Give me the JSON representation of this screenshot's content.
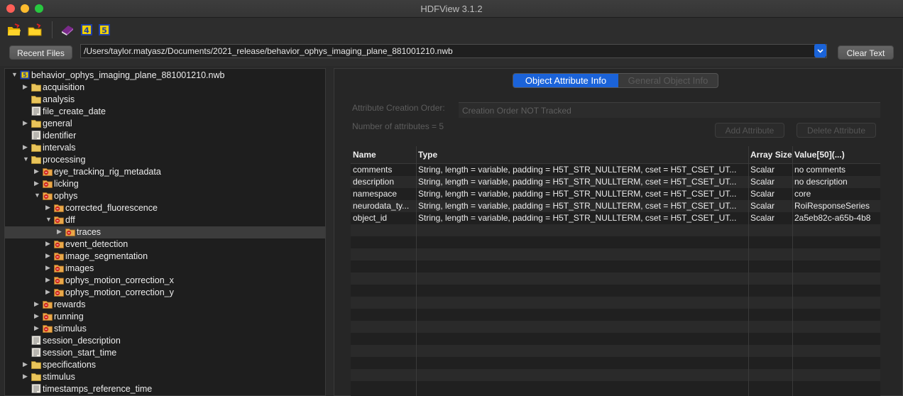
{
  "window": {
    "title": "HDFView 3.1.2"
  },
  "toolbar": {
    "icons": [
      "open-file-icon",
      "open-folder-icon",
      "help-book-icon",
      "hdf4-icon",
      "hdf5-icon"
    ]
  },
  "file_bar": {
    "recent_files_label": "Recent Files",
    "path": "/Users/taylor.matyasz/Documents/2021_release/behavior_ophys_imaging_plane_881001210.nwb",
    "clear_text_label": "Clear Text"
  },
  "tree": {
    "items": [
      {
        "label": "behavior_ophys_imaging_plane_881001210.nwb",
        "icon": "hdf5-file-icon",
        "depth": 0,
        "expanded": true
      },
      {
        "label": "acquisition",
        "icon": "folder-icon",
        "depth": 1,
        "expanded": false
      },
      {
        "label": "analysis",
        "icon": "folder-icon",
        "depth": 1,
        "leaf": true
      },
      {
        "label": "file_create_date",
        "icon": "dataset-icon",
        "depth": 1,
        "leaf": true
      },
      {
        "label": "general",
        "icon": "folder-icon",
        "depth": 1,
        "expanded": false
      },
      {
        "label": "identifier",
        "icon": "dataset-icon",
        "depth": 1,
        "leaf": true
      },
      {
        "label": "intervals",
        "icon": "folder-icon",
        "depth": 1,
        "expanded": false
      },
      {
        "label": "processing",
        "icon": "folder-icon",
        "depth": 1,
        "expanded": true
      },
      {
        "label": "eye_tracking_rig_metadata",
        "icon": "group-attr-icon",
        "depth": 2,
        "expanded": false
      },
      {
        "label": "licking",
        "icon": "group-attr-icon",
        "depth": 2,
        "expanded": false
      },
      {
        "label": "ophys",
        "icon": "group-attr-icon",
        "depth": 2,
        "expanded": true
      },
      {
        "label": "corrected_fluorescence",
        "icon": "group-attr-icon",
        "depth": 3,
        "expanded": false
      },
      {
        "label": "dff",
        "icon": "group-attr-icon",
        "depth": 3,
        "expanded": true
      },
      {
        "label": "traces",
        "icon": "group-attr-icon",
        "depth": 4,
        "expanded": false,
        "selected": true
      },
      {
        "label": "event_detection",
        "icon": "group-attr-icon",
        "depth": 3,
        "expanded": false
      },
      {
        "label": "image_segmentation",
        "icon": "group-attr-icon",
        "depth": 3,
        "expanded": false
      },
      {
        "label": "images",
        "icon": "group-attr-icon",
        "depth": 3,
        "expanded": false
      },
      {
        "label": "ophys_motion_correction_x",
        "icon": "group-attr-icon",
        "depth": 3,
        "expanded": false
      },
      {
        "label": "ophys_motion_correction_y",
        "icon": "group-attr-icon",
        "depth": 3,
        "expanded": false
      },
      {
        "label": "rewards",
        "icon": "group-attr-icon",
        "depth": 2,
        "expanded": false
      },
      {
        "label": "running",
        "icon": "group-attr-icon",
        "depth": 2,
        "expanded": false
      },
      {
        "label": "stimulus",
        "icon": "group-attr-icon",
        "depth": 2,
        "expanded": false
      },
      {
        "label": "session_description",
        "icon": "dataset-icon",
        "depth": 1,
        "leaf": true
      },
      {
        "label": "session_start_time",
        "icon": "dataset-icon",
        "depth": 1,
        "leaf": true
      },
      {
        "label": "specifications",
        "icon": "folder-icon",
        "depth": 1,
        "expanded": false
      },
      {
        "label": "stimulus",
        "icon": "folder-icon",
        "depth": 1,
        "expanded": false
      },
      {
        "label": "timestamps_reference_time",
        "icon": "dataset-icon",
        "depth": 1,
        "leaf": true
      }
    ]
  },
  "tabs": [
    {
      "label": "Object Attribute Info",
      "active": true
    },
    {
      "label": "General Object Info",
      "active": false
    }
  ],
  "attributes_panel": {
    "creation_order_label": "Attribute Creation Order:",
    "creation_order_value": "Creation Order NOT Tracked",
    "count_label": "Number of attributes = 5",
    "add_button": "Add Attribute",
    "delete_button": "Delete Attribute",
    "columns": [
      "Name",
      "Type",
      "Array Size",
      "Value[50](...)"
    ],
    "rows": [
      [
        "comments",
        "String, length = variable, padding = H5T_STR_NULLTERM, cset = H5T_CSET_UT...",
        "Scalar",
        "no comments"
      ],
      [
        "description",
        "String, length = variable, padding = H5T_STR_NULLTERM, cset = H5T_CSET_UT...",
        "Scalar",
        "no description"
      ],
      [
        "namespace",
        "String, length = variable, padding = H5T_STR_NULLTERM, cset = H5T_CSET_UT...",
        "Scalar",
        "core"
      ],
      [
        "neurodata_ty...",
        "String, length = variable, padding = H5T_STR_NULLTERM, cset = H5T_CSET_UT...",
        "Scalar",
        "RoiResponseSeries"
      ],
      [
        "object_id",
        "String, length = variable, padding = H5T_STR_NULLTERM, cset = H5T_CSET_UT...",
        "Scalar",
        "2a5eb82c-a65b-4b8"
      ]
    ]
  },
  "colors": {
    "accent": "#1b63d9",
    "background": "#2a2a2a"
  }
}
